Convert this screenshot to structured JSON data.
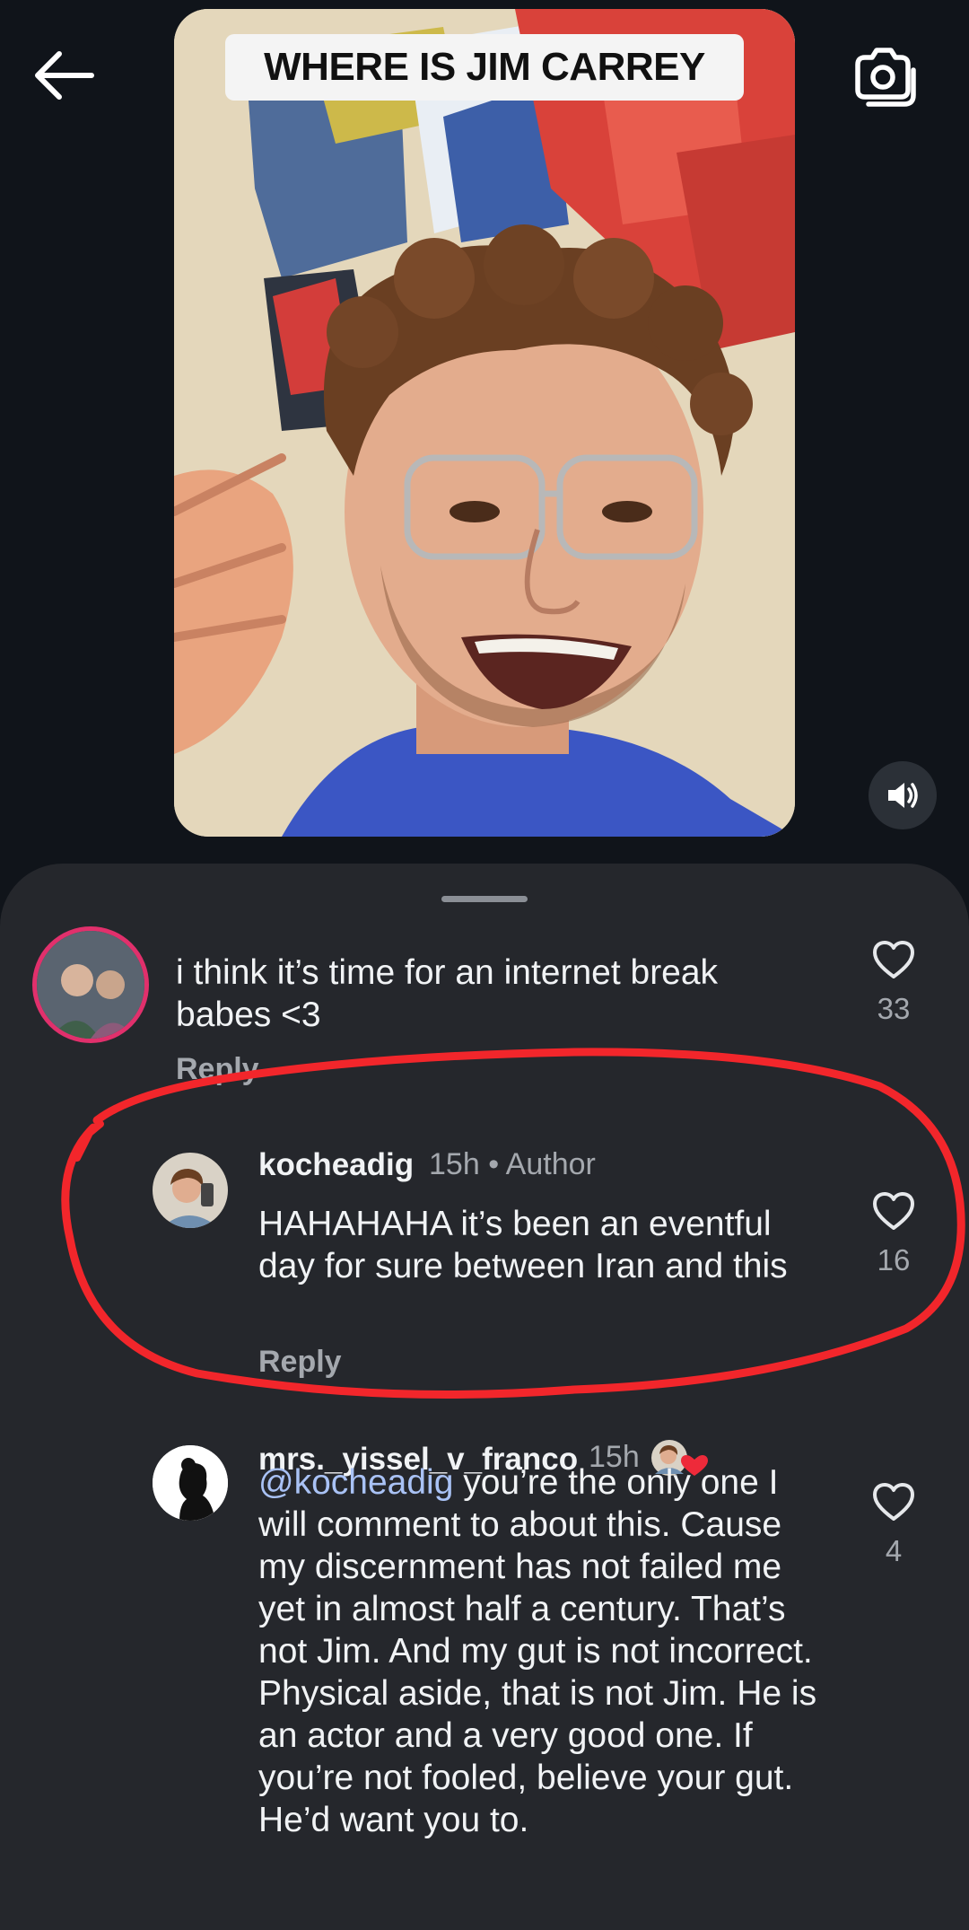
{
  "video": {
    "caption": "WHERE IS JIM CARREY"
  },
  "icons": {
    "back": "arrow-left-icon",
    "camera": "camera-icon",
    "mute": "speaker-icon",
    "like": "heart-outline-icon"
  },
  "colors": {
    "background": "#10141a",
    "sheet": "#25272c",
    "mention": "#a9c2f5",
    "annotation": "#f2262b"
  },
  "comments": [
    {
      "text": "i think it’s time for an internet break babes <3",
      "reply_label": "Reply",
      "likes": "33"
    },
    {
      "username": "kocheadig",
      "time": "15h",
      "separator": "•",
      "badge": "Author",
      "text": "HAHAHAHA it’s been an eventful day for sure between Iran and this",
      "reply_label": "Reply",
      "likes": "16"
    },
    {
      "username": "mrs._yissel_v_franco",
      "time": "15h",
      "mention": "@kocheadig",
      "text": " you’re the only one I will comment to about this. Cause my discernment has not failed me yet in almost half a century. That’s not Jim. And my gut is not incorrect. Physical aside, that is not Jim. He is an actor and a very good one. If you’re not fooled, believe your gut. He’d want you to.",
      "likes": "4"
    }
  ]
}
